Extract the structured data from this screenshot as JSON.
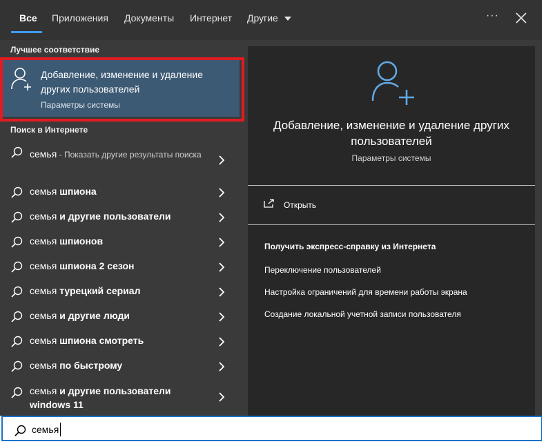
{
  "tabs": [
    {
      "label": "Все",
      "active": true
    },
    {
      "label": "Приложения"
    },
    {
      "label": "Документы"
    },
    {
      "label": "Интернет"
    },
    {
      "label": "Другие"
    }
  ],
  "more_label": "···",
  "best_match": {
    "section_title": "Лучшее соответствие",
    "title": "Добавление, изменение и удаление других пользователей",
    "subtitle": "Параметры системы"
  },
  "web_search": {
    "section_title": "Поиск в Интернете",
    "first_query": "семья",
    "first_note": " - Показать другие результаты поиска",
    "items": [
      {
        "prefix": "семья ",
        "bold": "шпиона"
      },
      {
        "prefix": "семья ",
        "bold": "и другие пользователи"
      },
      {
        "prefix": "семья ",
        "bold": "шпионов"
      },
      {
        "prefix": "семья ",
        "bold": "шпиона 2 сезон"
      },
      {
        "prefix": "семья ",
        "bold": "турецкий сериал"
      },
      {
        "prefix": "семья ",
        "bold": "и другие люди"
      },
      {
        "prefix": "семья ",
        "bold": "шпиона смотреть"
      },
      {
        "prefix": "семья ",
        "bold": "по быстрому"
      }
    ],
    "last_item": {
      "prefix": "семья ",
      "bold_line1": "и другие пользователи",
      "bold_line2": "windows 11"
    }
  },
  "detail": {
    "title": "Добавление, изменение и удаление других пользователей",
    "subtitle": "Параметры системы",
    "open_label": "Открыть",
    "help_title": "Получить экспресс-справку из Интернета",
    "help_links": [
      "Переключение пользователей",
      "Настройка ограничений для времени работы экрана",
      "Создание локальной учетной записи пользователя"
    ]
  },
  "search": {
    "value": "семья"
  },
  "colors": {
    "accent": "#3f9bf2",
    "highlight_frame": "#e21b22",
    "selected_bg": "#3d5a74"
  }
}
